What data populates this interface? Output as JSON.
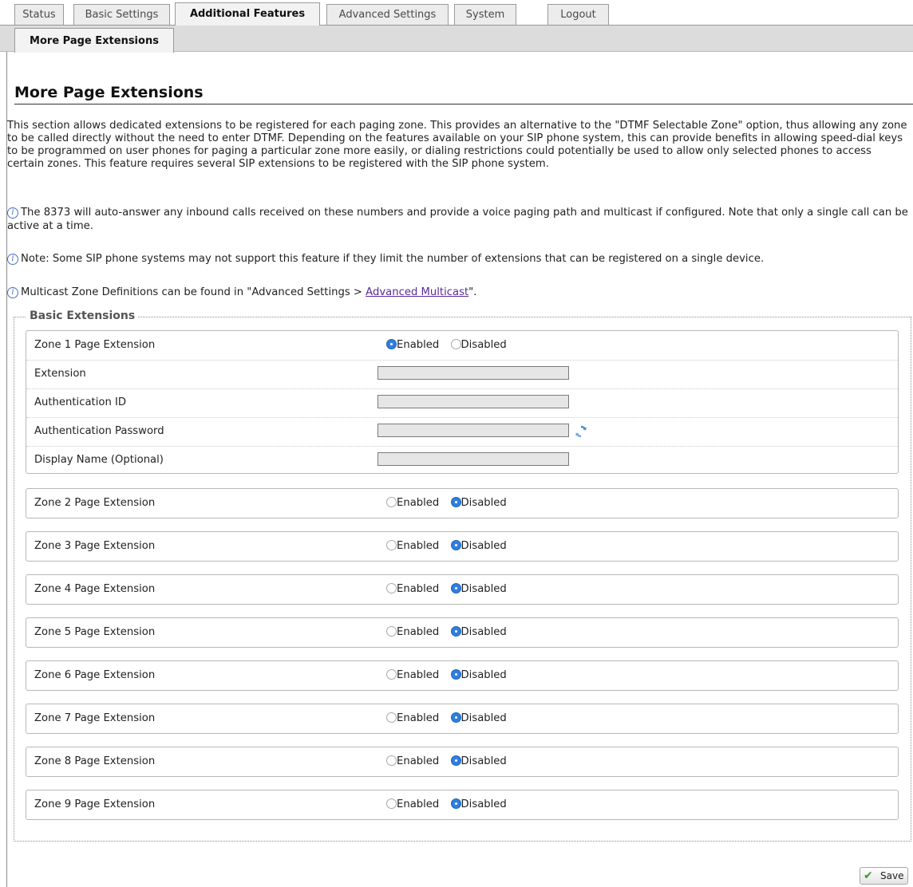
{
  "tabs": [
    {
      "label": "Status"
    },
    {
      "label": "Basic Settings"
    },
    {
      "label": "Additional Features"
    },
    {
      "label": "Advanced Settings"
    },
    {
      "label": "System"
    },
    {
      "label": "Logout"
    }
  ],
  "active_tab": "Additional Features",
  "subtab": {
    "label": "More Page Extensions"
  },
  "page": {
    "title": "More Page Extensions",
    "description": "This section allows dedicated extensions to be registered for each paging zone. This provides an alternative to the \"DTMF Selectable Zone\" option, thus allowing any zone to be called directly without the need to enter DTMF. Depending on the features available on your SIP phone system, this can provide benefits in allowing speed-dial keys to be programmed on user phones for paging a particular zone more easily, or dialing restrictions could potentially be used to allow only selected phones to access certain zones. This feature requires several SIP extensions to be registered with the SIP phone system.",
    "note1": "The 8373 will auto-answer any inbound calls received on these numbers and provide a voice paging path and multicast if configured. Note that only a single call can be active at a time.",
    "note2": "Note: Some SIP phone systems may not support this feature if they limit the number of extensions that can be registered on a single device.",
    "note3_prefix": "Multicast Zone Definitions can be found in \"Advanced Settings > ",
    "note3_link": "Advanced Multicast",
    "note3_suffix": "\"."
  },
  "basic_extensions": {
    "legend": "Basic Extensions",
    "radio_enabled": "Enabled",
    "radio_disabled": "Disabled",
    "zone1": {
      "label": "Zone 1 Page Extension",
      "state": "enabled",
      "fields": [
        {
          "label": "Extension",
          "value": ""
        },
        {
          "label": "Authentication ID",
          "value": ""
        },
        {
          "label": "Authentication Password",
          "value": ""
        },
        {
          "label": "Display Name (Optional)",
          "value": ""
        }
      ]
    },
    "zones": [
      {
        "label": "Zone 2 Page Extension",
        "state": "disabled"
      },
      {
        "label": "Zone 3 Page Extension",
        "state": "disabled"
      },
      {
        "label": "Zone 4 Page Extension",
        "state": "disabled"
      },
      {
        "label": "Zone 5 Page Extension",
        "state": "disabled"
      },
      {
        "label": "Zone 6 Page Extension",
        "state": "disabled"
      },
      {
        "label": "Zone 7 Page Extension",
        "state": "disabled"
      },
      {
        "label": "Zone 8 Page Extension",
        "state": "disabled"
      },
      {
        "label": "Zone 9 Page Extension",
        "state": "disabled"
      }
    ]
  },
  "save_label": "Save",
  "icons": {
    "info": "info-circle-icon",
    "generate": "refresh-password-icon",
    "save": "checkmark-icon"
  },
  "colors": {
    "radio_selected": "#2f7fe0",
    "link": "#5a2a9a",
    "save_check": "#3a9a2a"
  }
}
